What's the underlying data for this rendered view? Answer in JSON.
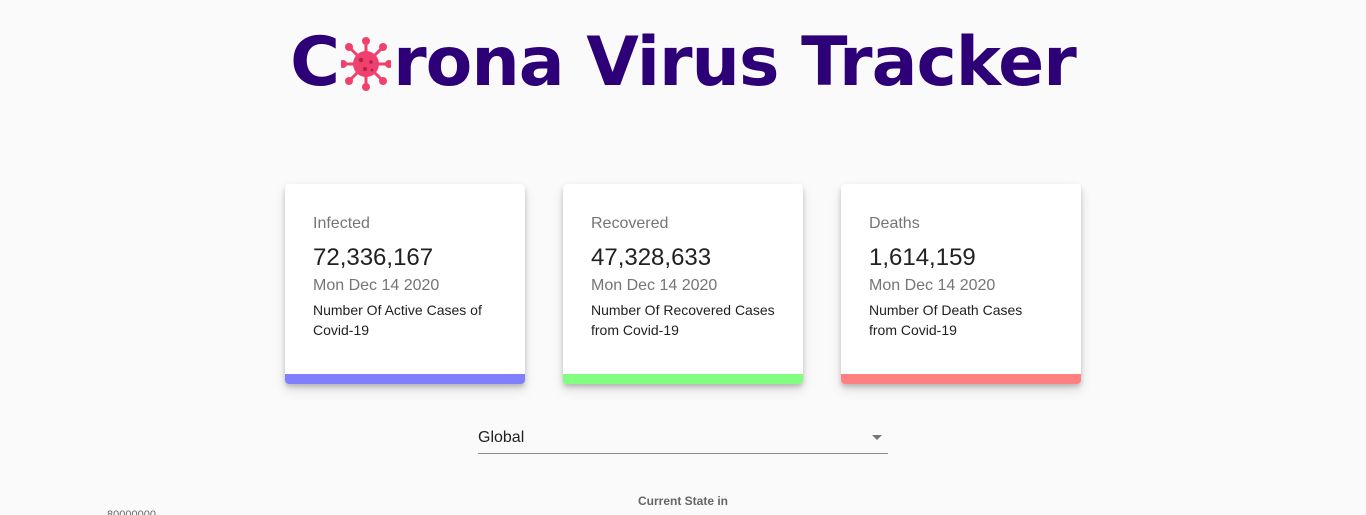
{
  "header": {
    "title_before": "C",
    "title_after": "rona Virus Tracker",
    "icon": "virus-icon"
  },
  "cards": [
    {
      "label": "Infected",
      "value": "72,336,167",
      "date": "Mon Dec 14 2020",
      "description": "Number Of Active Cases of Covid-19",
      "color": "#8080ff"
    },
    {
      "label": "Recovered",
      "value": "47,328,633",
      "date": "Mon Dec 14 2020",
      "description": "Number Of Recovered Cases from Covid-19",
      "color": "#80ff80"
    },
    {
      "label": "Deaths",
      "value": "1,614,159",
      "date": "Mon Dec 14 2020",
      "description": "Number Of Death Cases from Covid-19",
      "color": "#ff8080"
    }
  ],
  "country_select": {
    "selected": "Global"
  },
  "chart": {
    "title": "Current State in",
    "top_tick": "80000000"
  },
  "colors": {
    "title": "#2e0078",
    "virus": "#f0406e"
  }
}
